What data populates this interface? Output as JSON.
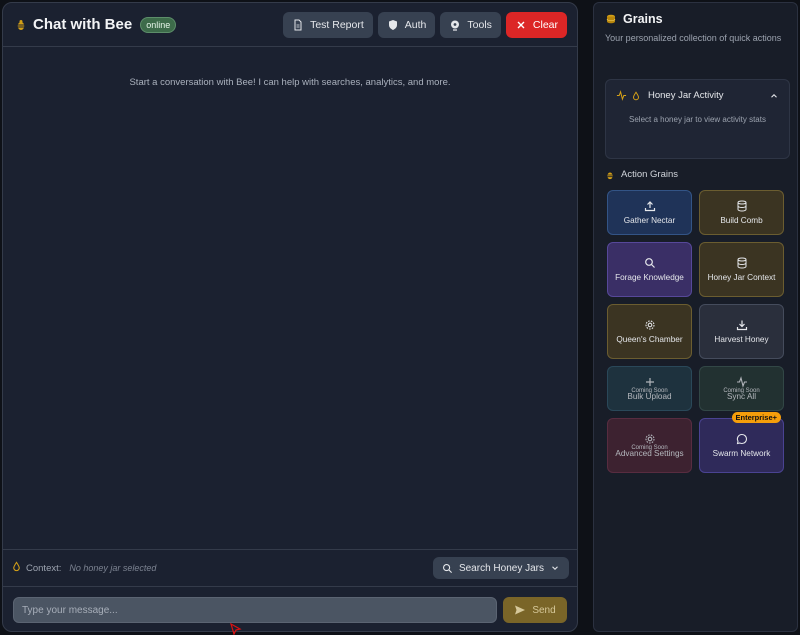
{
  "chat": {
    "title": "Chat with Bee",
    "status": "online",
    "actions": {
      "test_report": "Test Report",
      "auth": "Auth",
      "tools": "Tools",
      "clear": "Clear"
    },
    "empty_message": "Start a conversation with Bee! I can help with searches, analytics, and more.",
    "context": {
      "label": "Context:",
      "value": "No honey jar selected",
      "search_button": "Search Honey Jars"
    },
    "input": {
      "placeholder": "Type your message...",
      "value": ""
    },
    "send_label": "Send"
  },
  "grains": {
    "title": "Grains",
    "subtitle": "Your personalized collection of quick actions",
    "activity": {
      "title": "Honey Jar Activity",
      "body": "Select a honey jar to view activity stats"
    },
    "action_label": "Action Grains",
    "tiles": [
      {
        "label": "Gather Nectar",
        "icon": "upload-icon"
      },
      {
        "label": "Build Comb",
        "icon": "database-icon"
      },
      {
        "label": "Forage Knowledge",
        "icon": "search-icon"
      },
      {
        "label": "Honey Jar Context",
        "icon": "database-icon"
      },
      {
        "label": "Queen's Chamber",
        "icon": "gear-icon"
      },
      {
        "label": "Harvest Honey",
        "icon": "download-icon"
      },
      {
        "label": "Bulk Upload",
        "icon": "plus-icon",
        "badge": "Coming Soon"
      },
      {
        "label": "Sync All",
        "icon": "activity-icon",
        "badge": "Coming Soon"
      },
      {
        "label": "Advanced Settings",
        "icon": "gear-icon",
        "badge": "Coming Soon"
      },
      {
        "label": "Swarm Network",
        "icon": "message-icon",
        "tag": "Enterprise+"
      }
    ]
  },
  "colors": {
    "accent_gold": "#d4a017",
    "danger": "#dc2626",
    "online": "#3d6b4a",
    "enterprise": "#f59e0b"
  }
}
